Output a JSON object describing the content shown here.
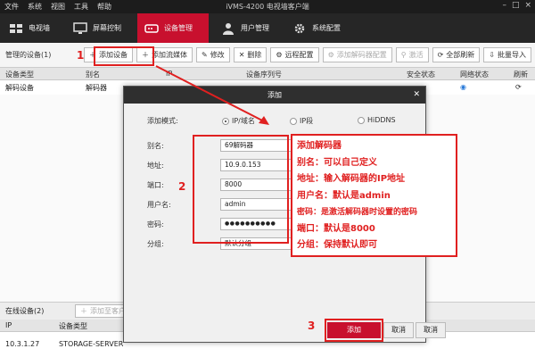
{
  "menubar": {
    "items": [
      "文件",
      "系统",
      "视图",
      "工具",
      "帮助"
    ],
    "title": "iVMS-4200 电视墙客户端"
  },
  "nav": {
    "tabs": [
      {
        "label": "电视墙",
        "icon": "tv-wall-icon",
        "active": false
      },
      {
        "label": "屏幕控制",
        "icon": "screen-control-icon",
        "active": false
      },
      {
        "label": "设备管理",
        "icon": "device-management-icon",
        "active": true
      },
      {
        "label": "用户管理",
        "icon": "user-icon",
        "active": false
      },
      {
        "label": "系统配置",
        "icon": "gear-icon",
        "active": false
      }
    ]
  },
  "toolbar": {
    "label": "管理的设备(1)",
    "buttons": [
      "添加设备",
      "添加流媒体",
      "修改",
      "删除",
      "远程配置",
      "添加解码器配置",
      "激活",
      "全部刷新",
      "批量导入"
    ]
  },
  "table": {
    "headers": [
      "设备类型",
      "别名",
      "IP",
      "设备序列号",
      "安全状态",
      "网络状态",
      "刷新"
    ],
    "row": {
      "type": "解码设备",
      "alias": "解码器"
    }
  },
  "bottom": {
    "label": "在线设备(2)",
    "add_button": "添加至客户端",
    "headers": [
      "IP",
      "设备类型"
    ],
    "row": {
      "ip": "10.3.1.27",
      "type": "STORAGE-SERVER"
    }
  },
  "dialog": {
    "title": "添加",
    "mode_label": "添加模式:",
    "modes": [
      "IP/域名",
      "IP段",
      "HiDDNS"
    ],
    "fields": {
      "alias_label": "别名:",
      "alias_value": "69解码器",
      "address_label": "地址:",
      "address_value": "10.9.0.153",
      "port_label": "端口:",
      "port_value": "8000",
      "username_label": "用户名:",
      "username_value": "admin",
      "password_label": "密码:",
      "password_value": "●●●●●●●●●●",
      "group_label": "分组:",
      "group_value": "默认分组"
    },
    "add_button": "添加",
    "cancel_button": "取消",
    "cancel_labels": [
      "取消",
      "取消"
    ]
  },
  "annotation": {
    "lines": [
      "添加解码器",
      "别名：可以自己定义",
      "地址：输入解码器的IP地址",
      "用户名：默认是admin",
      "密码：是激活解码器时设置的密码",
      "端口：默认是8000",
      "分组：保持默认即可"
    ],
    "steps": [
      "1",
      "2",
      "3"
    ],
    "color": "#e02020"
  },
  "colors": {
    "accent": "#c8102e",
    "nav_bg": "#262626",
    "annotation": "#e02020"
  }
}
